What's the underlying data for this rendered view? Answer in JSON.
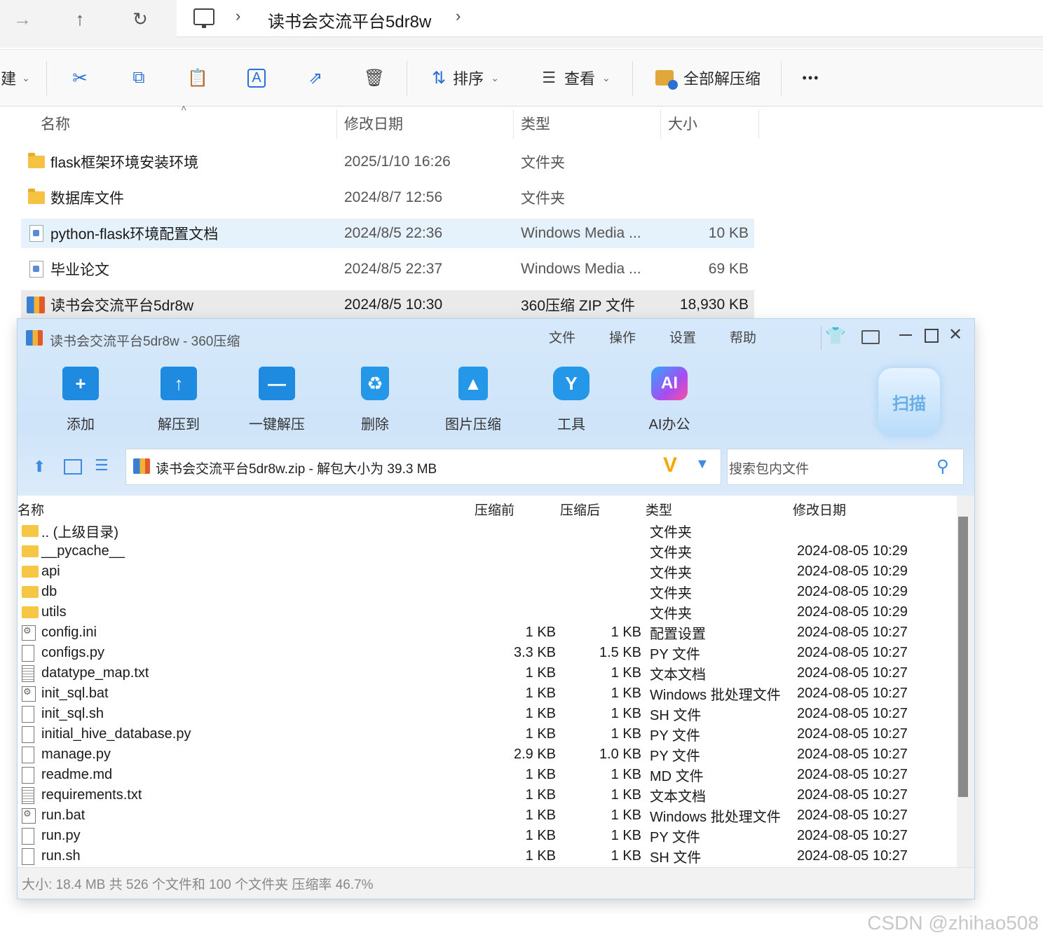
{
  "explorer": {
    "breadcrumb": {
      "folder": "读书会交流平台5dr8w"
    },
    "toolbar": {
      "new_label": "建",
      "sort_label": "排序",
      "view_label": "查看",
      "extract_all_label": "全部解压缩",
      "more_label": "•••"
    },
    "columns": {
      "name": "名称",
      "modified": "修改日期",
      "type": "类型",
      "size": "大小"
    },
    "files": [
      {
        "name": "flask框架环境安装环境",
        "modified": "2025/1/10 16:26",
        "type": "文件夹",
        "size": "",
        "icon": "folder-icon"
      },
      {
        "name": "数据库文件",
        "modified": "2024/8/7 12:56",
        "type": "文件夹",
        "size": "",
        "icon": "folder-icon"
      },
      {
        "name": "python-flask环境配置文档",
        "modified": "2024/8/5 22:36",
        "type": "Windows Media ...",
        "size": "10 KB",
        "icon": "media-file-icon"
      },
      {
        "name": "毕业论文",
        "modified": "2024/8/5 22:37",
        "type": "Windows Media ...",
        "size": "69 KB",
        "icon": "media-file-icon"
      },
      {
        "name": "读书会交流平台5dr8w",
        "modified": "2024/8/5 10:30",
        "type": "360压缩 ZIP 文件",
        "size": "18,930 KB",
        "icon": "zip-icon"
      }
    ]
  },
  "zipwin": {
    "title": "读书会交流平台5dr8w - 360压缩",
    "menu": {
      "file": "文件",
      "ops": "操作",
      "settings": "设置",
      "help": "帮助"
    },
    "buttons": {
      "add": "添加",
      "extract_to": "解压到",
      "one_click": "一键解压",
      "delete": "删除",
      "image_compress": "图片压缩",
      "tools": "工具",
      "ai_office": "AI办公",
      "scan": "扫描"
    },
    "path": "读书会交流平台5dr8w.zip - 解包大小为 39.3 MB",
    "search_placeholder": "搜索包内文件",
    "columns": {
      "name": "名称",
      "before": "压缩前",
      "after": "压缩后",
      "type": "类型",
      "modified": "修改日期"
    },
    "rows": [
      {
        "name": ".. (上级目录)",
        "before": "",
        "after": "",
        "type": "文件夹",
        "modified": "",
        "icon": "folder"
      },
      {
        "name": "__pycache__",
        "before": "",
        "after": "",
        "type": "文件夹",
        "modified": "2024-08-05 10:29",
        "icon": "folder"
      },
      {
        "name": "api",
        "before": "",
        "after": "",
        "type": "文件夹",
        "modified": "2024-08-05 10:29",
        "icon": "folder"
      },
      {
        "name": "db",
        "before": "",
        "after": "",
        "type": "文件夹",
        "modified": "2024-08-05 10:29",
        "icon": "folder"
      },
      {
        "name": "utils",
        "before": "",
        "after": "",
        "type": "文件夹",
        "modified": "2024-08-05 10:29",
        "icon": "folder"
      },
      {
        "name": "config.ini",
        "before": "1 KB",
        "after": "1 KB",
        "type": "配置设置",
        "modified": "2024-08-05 10:27",
        "icon": "bat"
      },
      {
        "name": "configs.py",
        "before": "3.3 KB",
        "after": "1.5 KB",
        "type": "PY 文件",
        "modified": "2024-08-05 10:27",
        "icon": "file"
      },
      {
        "name": "datatype_map.txt",
        "before": "1 KB",
        "after": "1 KB",
        "type": "文本文档",
        "modified": "2024-08-05 10:27",
        "icon": "doc"
      },
      {
        "name": "init_sql.bat",
        "before": "1 KB",
        "after": "1 KB",
        "type": "Windows 批处理文件",
        "modified": "2024-08-05 10:27",
        "icon": "bat"
      },
      {
        "name": "init_sql.sh",
        "before": "1 KB",
        "after": "1 KB",
        "type": "SH 文件",
        "modified": "2024-08-05 10:27",
        "icon": "file"
      },
      {
        "name": "initial_hive_database.py",
        "before": "1 KB",
        "after": "1 KB",
        "type": "PY 文件",
        "modified": "2024-08-05 10:27",
        "icon": "file"
      },
      {
        "name": "manage.py",
        "before": "2.9 KB",
        "after": "1.0 KB",
        "type": "PY 文件",
        "modified": "2024-08-05 10:27",
        "icon": "file"
      },
      {
        "name": "readme.md",
        "before": "1 KB",
        "after": "1 KB",
        "type": "MD 文件",
        "modified": "2024-08-05 10:27",
        "icon": "file"
      },
      {
        "name": "requirements.txt",
        "before": "1 KB",
        "after": "1 KB",
        "type": "文本文档",
        "modified": "2024-08-05 10:27",
        "icon": "doc"
      },
      {
        "name": "run.bat",
        "before": "1 KB",
        "after": "1 KB",
        "type": "Windows 批处理文件",
        "modified": "2024-08-05 10:27",
        "icon": "bat"
      },
      {
        "name": "run.py",
        "before": "1 KB",
        "after": "1 KB",
        "type": "PY 文件",
        "modified": "2024-08-05 10:27",
        "icon": "file"
      },
      {
        "name": "run.sh",
        "before": "1 KB",
        "after": "1 KB",
        "type": "SH 文件",
        "modified": "2024-08-05 10:27",
        "icon": "file"
      }
    ],
    "status": "大小: 18.4 MB 共 526 个文件和 100 个文件夹 压缩率 46.7%"
  },
  "watermark": "CSDN @zhihao508"
}
